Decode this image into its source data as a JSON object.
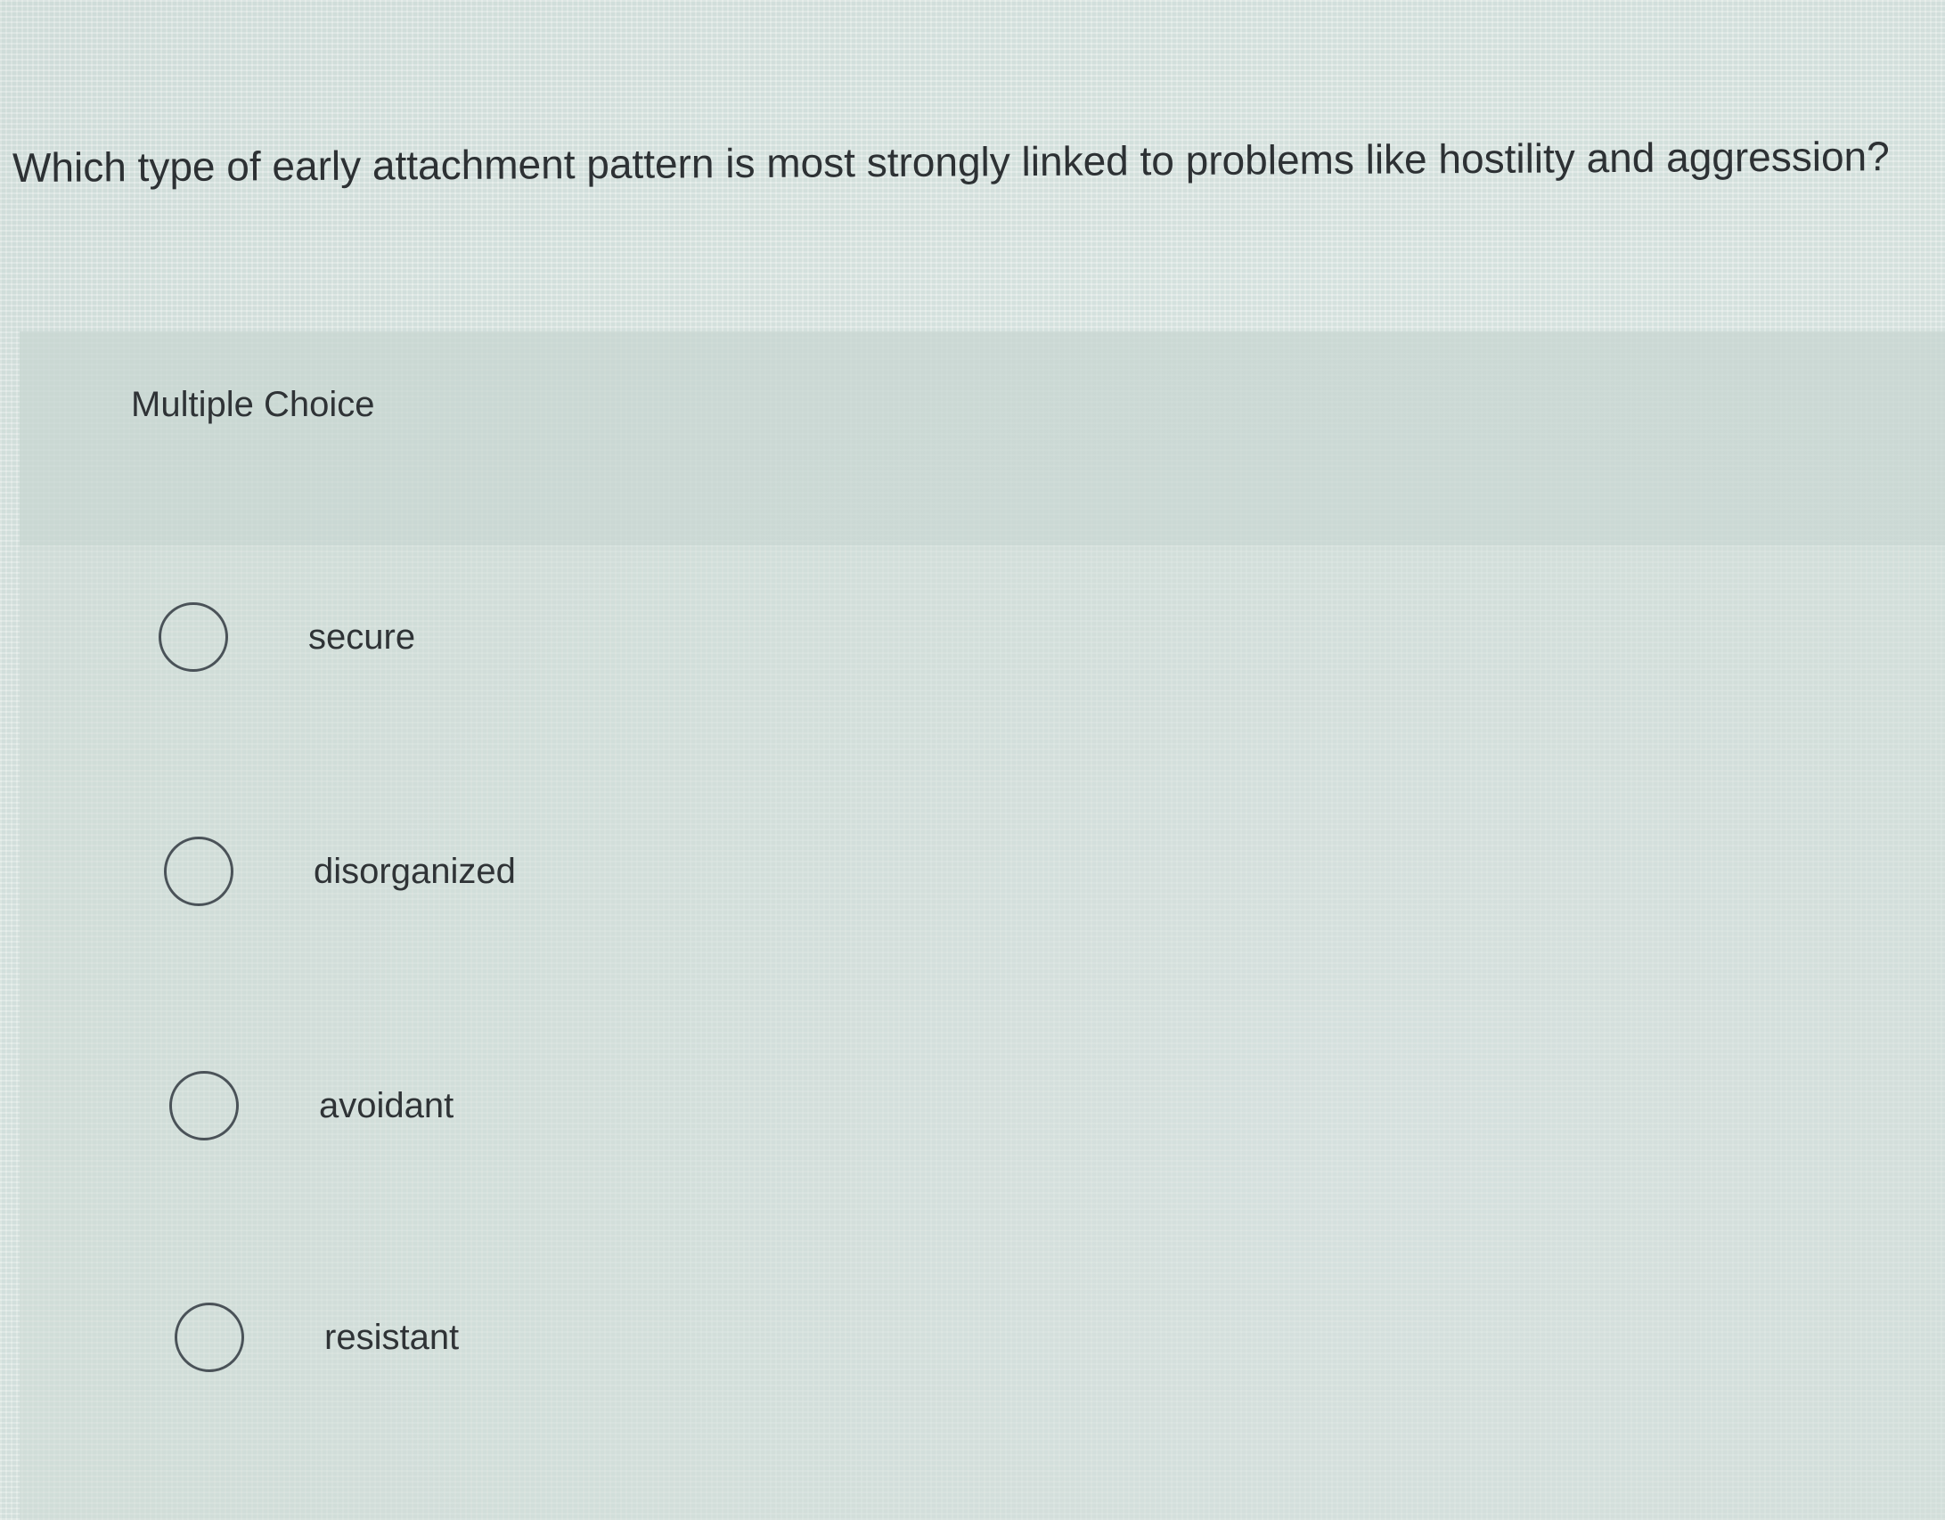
{
  "question": {
    "text": "Which type of early attachment pattern is most strongly linked to problems like hostility and aggression?"
  },
  "question_type": {
    "label": "Multiple Choice"
  },
  "options": [
    {
      "label": "secure",
      "selected": false
    },
    {
      "label": "disorganized",
      "selected": false
    },
    {
      "label": "avoidant",
      "selected": false
    },
    {
      "label": "resistant",
      "selected": false
    }
  ]
}
